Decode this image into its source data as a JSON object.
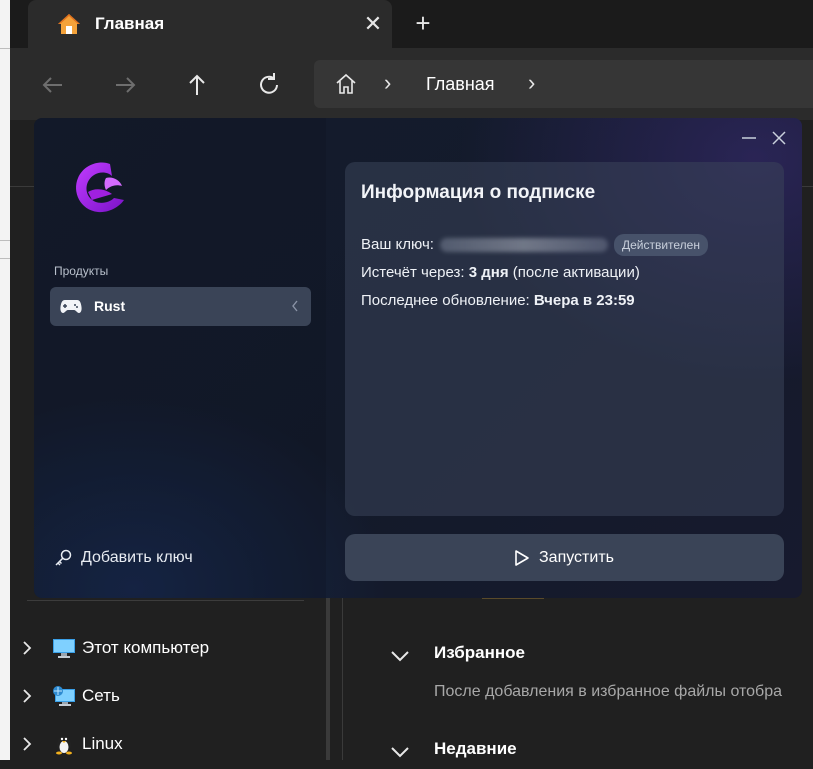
{
  "browser": {
    "tab_title": "Главная",
    "breadcrumb": [
      "Главная"
    ]
  },
  "explorer": {
    "tree": [
      {
        "label": "Этот компьютер",
        "icon": "computer-icon"
      },
      {
        "label": "Сеть",
        "icon": "network-icon"
      },
      {
        "label": "Linux",
        "icon": "linux-penguin-icon"
      }
    ],
    "sections": [
      {
        "label": "Избранное",
        "description": "После добавления в избранное файлы отобра"
      },
      {
        "label": "Недавние"
      }
    ]
  },
  "app": {
    "products_label": "Продукты",
    "products": [
      {
        "label": "Rust",
        "icon": "gamepad-icon"
      }
    ],
    "add_key_label": "Добавить ключ",
    "run_label": "Запустить",
    "subscription": {
      "title": "Информация о подписке",
      "key_label": "Ваш ключ:",
      "key_status": "Действителен",
      "expires_label": "Истечёт через:",
      "expires_value": "3 дня",
      "expires_note": "(после активации)",
      "updated_label": "Последнее обновление:",
      "updated_value": "Вчера в 23:59"
    }
  },
  "colors": {
    "accent_purple": "#b02cf0",
    "panel": "#3a4457",
    "badge": "#47526a"
  }
}
